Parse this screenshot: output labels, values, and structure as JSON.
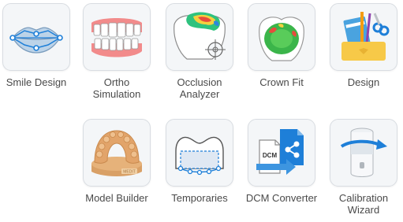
{
  "apps": [
    {
      "id": "smile-design",
      "label": "Smile Design",
      "icon": "lips-icon"
    },
    {
      "id": "ortho-simulation",
      "label": "Ortho\nSimulation",
      "icon": "teeth-icon"
    },
    {
      "id": "occlusion-analyzer",
      "label": "Occlusion\nAnalyzer",
      "icon": "occlusion-map-icon"
    },
    {
      "id": "crown-fit",
      "label": "Crown Fit",
      "icon": "crown-fit-icon"
    },
    {
      "id": "design",
      "label": "Design",
      "icon": "design-tools-icon"
    },
    {
      "id": "model-builder",
      "label": "Model Builder",
      "icon": "dental-model-icon",
      "badge": "MEDIT"
    },
    {
      "id": "temporaries",
      "label": "Temporaries",
      "icon": "temporary-crown-icon"
    },
    {
      "id": "dcm-converter",
      "label": "DCM Converter",
      "icon": "dcm-file-icon",
      "badge": "DCM"
    },
    {
      "id": "calibration-wizard",
      "label": "Calibration\nWizard",
      "icon": "calibration-icon"
    }
  ],
  "colors": {
    "tile_bg": "#f4f6f8",
    "tile_border": "#d9dde2",
    "accent_blue": "#1e7fd8",
    "label_text": "#4a4a4a"
  }
}
